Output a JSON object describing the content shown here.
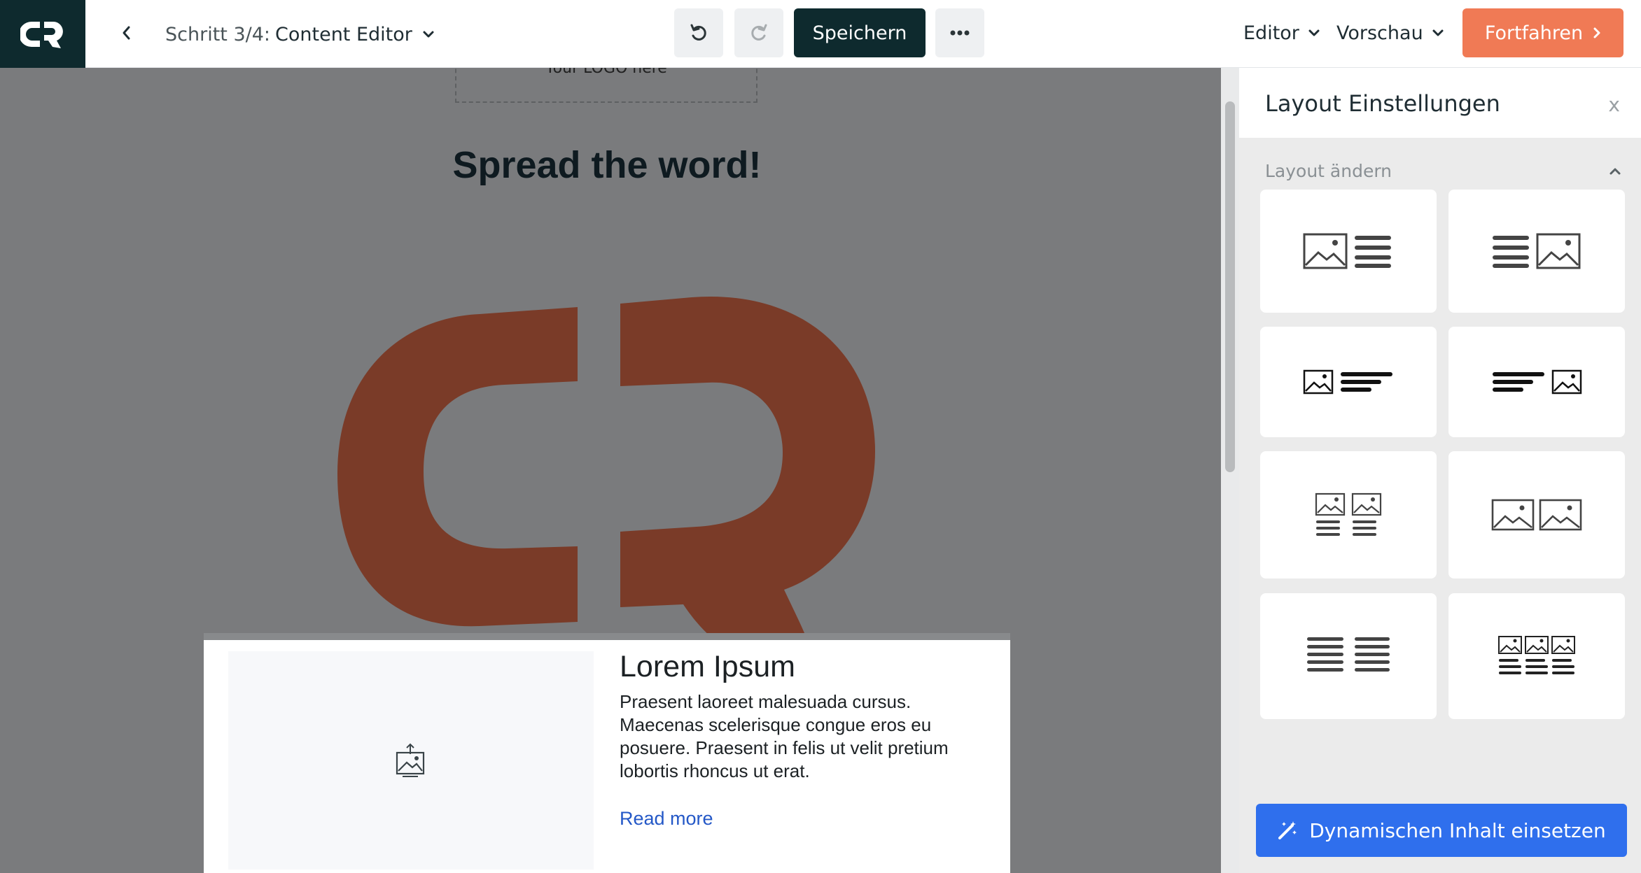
{
  "header": {
    "step_prefix": "Schritt 3/4:",
    "step_name": "Content Editor",
    "save_label": "Speichern",
    "editor_label": "Editor",
    "preview_label": "Vorschau",
    "continue_label": "Fortfahren"
  },
  "canvas": {
    "logo_placeholder_text": "Your LOGO here",
    "headline": "Spread the word!",
    "block": {
      "title": "Lorem Ipsum",
      "body": "Praesent laoreet malesuada cursus. Maecenas scelerisque congue eros eu posuere. Praesent in felis ut velit pretium lobortis rhoncus ut erat.",
      "link": "Read more"
    }
  },
  "panel": {
    "title": "Layout Einstellungen",
    "close_label": "x",
    "section_label": "Layout ändern",
    "layouts": [
      "image-left-text-right-icon",
      "text-left-image-right-icon",
      "small-image-left-text-icon",
      "text-left-small-image-icon",
      "two-columns-image-text-icon",
      "two-images-icon",
      "two-text-columns-icon",
      "three-columns-image-text-icon"
    ],
    "dynamic_button": "Dynamischen Inhalt einsetzen"
  },
  "colors": {
    "brand_dark": "#0e2a2e",
    "accent_orange": "#f07a55",
    "logo_rust": "#7a3b28",
    "primary_blue": "#2f6fed",
    "link_blue": "#2458c7"
  }
}
